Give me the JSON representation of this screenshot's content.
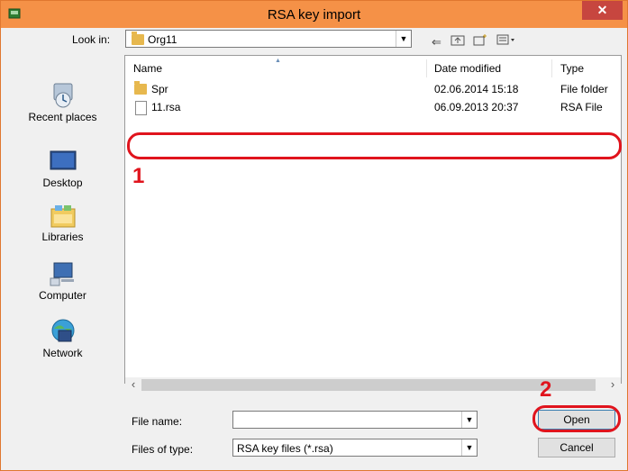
{
  "window": {
    "title": "RSA key import",
    "close_glyph": "✕",
    "accent": "#f59147"
  },
  "lookin": {
    "label": "Look in:",
    "value": "Org11"
  },
  "places": [
    {
      "label": "Recent places",
      "icon": "recent-places-icon"
    },
    {
      "label": "Desktop",
      "icon": "desktop-icon"
    },
    {
      "label": "Libraries",
      "icon": "libraries-icon"
    },
    {
      "label": "Computer",
      "icon": "computer-icon"
    },
    {
      "label": "Network",
      "icon": "network-icon"
    }
  ],
  "list": {
    "columns": {
      "name": "Name",
      "date": "Date modified",
      "type": "Type"
    },
    "rows": [
      {
        "name": "Spr",
        "date": "02.06.2014 15:18",
        "type": "File folder",
        "icon": "folder-icon"
      },
      {
        "name": "11.rsa",
        "date": "06.09.2013 20:37",
        "type": "RSA File",
        "icon": "file-icon"
      }
    ]
  },
  "filename": {
    "label": "File name:",
    "value": ""
  },
  "filetype": {
    "label": "Files of type:",
    "value": "RSA key files (*.rsa)"
  },
  "buttons": {
    "open": "Open",
    "cancel": "Cancel"
  },
  "annotations": {
    "one": "1",
    "two": "2",
    "color": "#e0141d"
  }
}
